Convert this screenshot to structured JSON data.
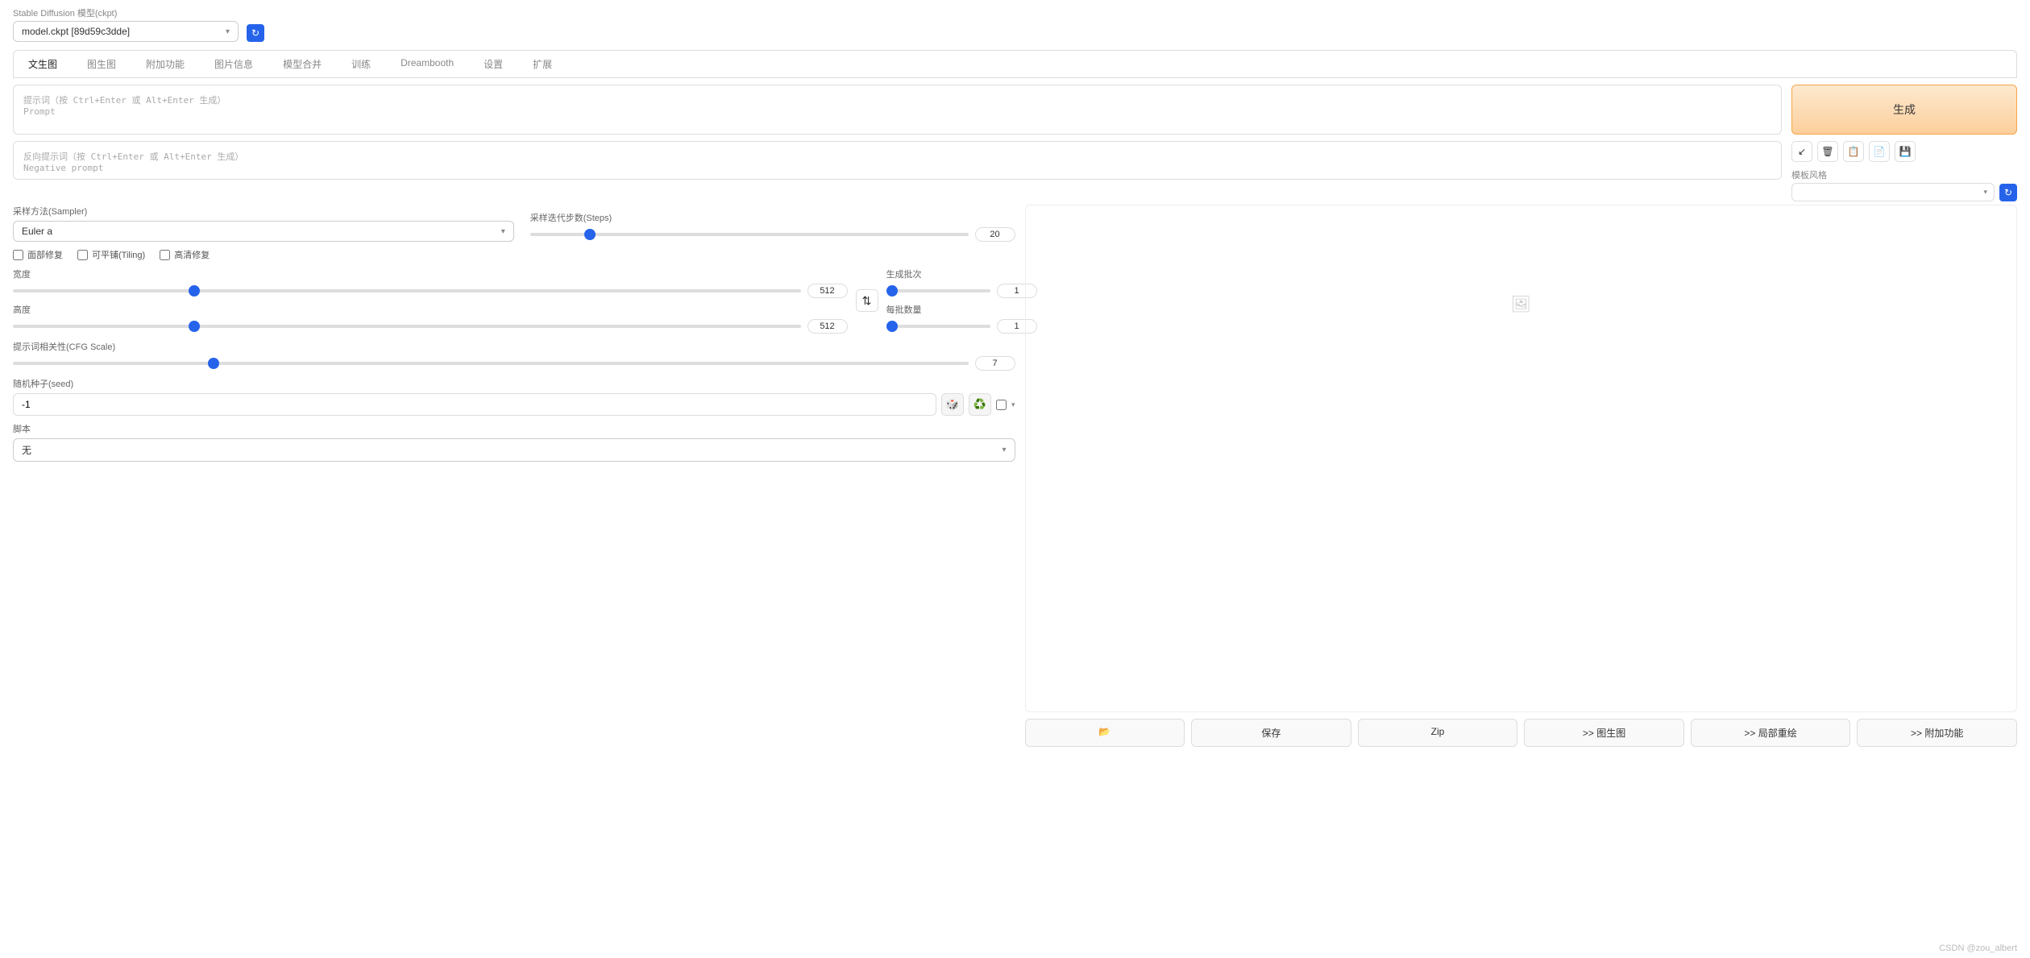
{
  "header": {
    "checkpoint_label": "Stable Diffusion 模型(ckpt)",
    "checkpoint_value": "model.ckpt [89d59c3dde]"
  },
  "tabs": [
    "文生图",
    "图生图",
    "附加功能",
    "图片信息",
    "模型合并",
    "训练",
    "Dreambooth",
    "设置",
    "扩展"
  ],
  "prompt": {
    "placeholder": "提示词（按 Ctrl+Enter 或 Alt+Enter 生成）\nPrompt",
    "neg_placeholder": "反向提示词（按 Ctrl+Enter 或 Alt+Enter 生成）\nNegative prompt"
  },
  "generate_label": "生成",
  "style_label": "模板风格",
  "sampler": {
    "label": "采样方法(Sampler)",
    "value": "Euler a"
  },
  "steps": {
    "label": "采样迭代步数(Steps)",
    "value": 20
  },
  "checks": {
    "face": "面部修复",
    "tiling": "可平铺(Tiling)",
    "hires": "高清修复"
  },
  "width": {
    "label": "宽度",
    "value": 512
  },
  "height": {
    "label": "高度",
    "value": 512
  },
  "batch_count": {
    "label": "生成批次",
    "value": 1
  },
  "batch_size": {
    "label": "每批数量",
    "value": 1
  },
  "cfg": {
    "label": "提示词相关性(CFG Scale)",
    "value": 7
  },
  "seed": {
    "label": "随机种子(seed)",
    "value": "-1"
  },
  "script": {
    "label": "脚本",
    "value": "无"
  },
  "output_buttons": {
    "folder": "📂",
    "save": "保存",
    "zip": "Zip",
    "img2img": ">> 图生图",
    "inpaint": ">> 局部重绘",
    "extras": ">> 附加功能"
  },
  "watermark": "CSDN @zou_albert"
}
